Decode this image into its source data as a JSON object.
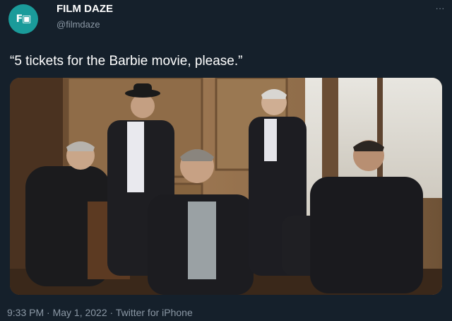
{
  "account": {
    "avatar_icon": "film-daze-logo-icon",
    "name": "FILM DAZE",
    "handle": "@filmdaze",
    "more_label": "..."
  },
  "tweet": {
    "text": "“5 tickets for the Barbie movie, please.”",
    "photo_icon": "photo-five-men-in-dark-suits"
  },
  "meta": {
    "line": "9:33 PM · May 1, 2022 · Twitter for iPhone"
  },
  "colors": {
    "background": "#15202b",
    "secondary_text": "#8b98a5",
    "avatar_teal": "#1a9b9a"
  }
}
